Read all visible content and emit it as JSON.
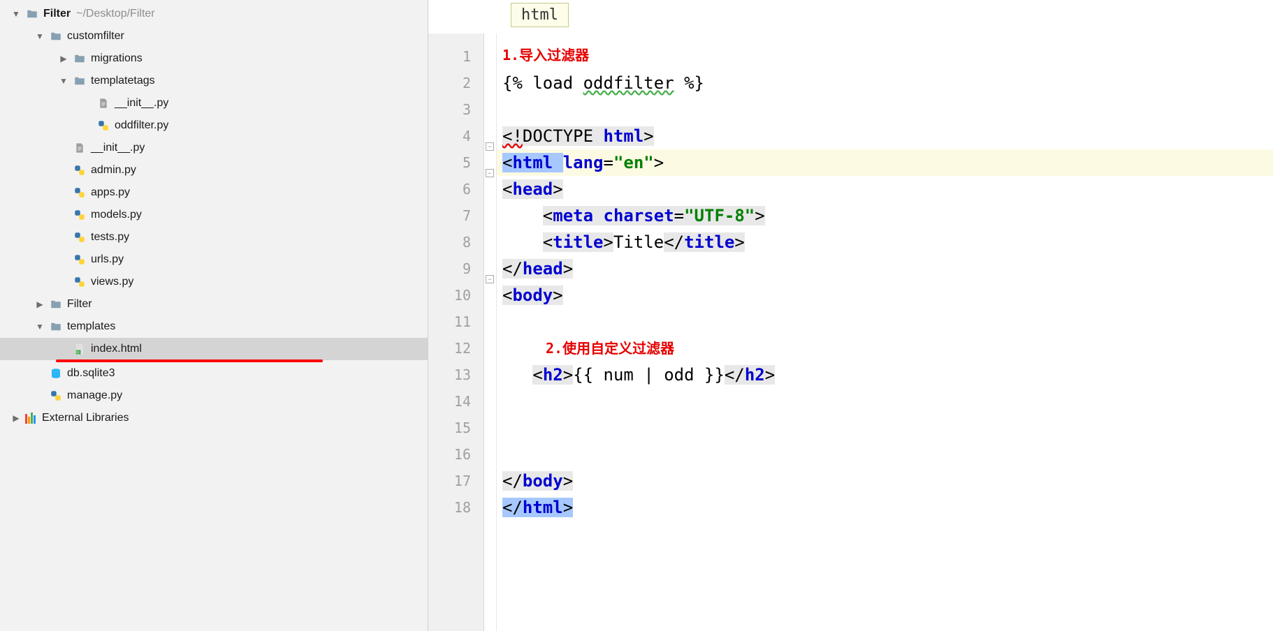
{
  "project": {
    "name": "Filter",
    "path": "~/Desktop/Filter"
  },
  "tree": [
    {
      "depth": 0,
      "arrow": "down",
      "icon": "folder",
      "label": "Filter",
      "bold": true,
      "path": "~/Desktop/Filter"
    },
    {
      "depth": 1,
      "arrow": "down",
      "icon": "folder",
      "label": "customfilter"
    },
    {
      "depth": 2,
      "arrow": "right",
      "icon": "folder",
      "label": "migrations"
    },
    {
      "depth": 2,
      "arrow": "down",
      "icon": "folder",
      "label": "templatetags"
    },
    {
      "depth": 3,
      "arrow": "none",
      "icon": "txt",
      "label": "__init__.py"
    },
    {
      "depth": 3,
      "arrow": "none",
      "icon": "py",
      "label": "oddfilter.py"
    },
    {
      "depth": 2,
      "arrow": "none",
      "icon": "txt",
      "label": "__init__.py"
    },
    {
      "depth": 2,
      "arrow": "none",
      "icon": "py",
      "label": "admin.py"
    },
    {
      "depth": 2,
      "arrow": "none",
      "icon": "py",
      "label": "apps.py"
    },
    {
      "depth": 2,
      "arrow": "none",
      "icon": "py",
      "label": "models.py"
    },
    {
      "depth": 2,
      "arrow": "none",
      "icon": "py",
      "label": "tests.py"
    },
    {
      "depth": 2,
      "arrow": "none",
      "icon": "py",
      "label": "urls.py"
    },
    {
      "depth": 2,
      "arrow": "none",
      "icon": "py",
      "label": "views.py"
    },
    {
      "depth": 1,
      "arrow": "right",
      "icon": "folder",
      "label": "Filter"
    },
    {
      "depth": 1,
      "arrow": "down",
      "icon": "folder",
      "label": "templates"
    },
    {
      "depth": 2,
      "arrow": "none",
      "icon": "html",
      "label": "index.html",
      "selected": true,
      "underline": true
    },
    {
      "depth": 1,
      "arrow": "none",
      "icon": "db",
      "label": "db.sqlite3"
    },
    {
      "depth": 1,
      "arrow": "none",
      "icon": "py",
      "label": "manage.py"
    },
    {
      "depth": 0,
      "arrow": "right",
      "icon": "lib",
      "label": "External Libraries"
    }
  ],
  "breadcrumb": "html",
  "annotations": {
    "a1": "1.导入过滤器",
    "a2": "2.使用自定义过滤器"
  },
  "code": {
    "l2_load": "{% load ",
    "l2_odd": "oddfilter",
    "l2_end": " %}",
    "l4_a": "<!",
    "l4_b": "DOCTYPE ",
    "l4_c": "html",
    "l4_d": ">",
    "l5_a": "<",
    "l5_b": "html ",
    "l5_c": "lang",
    "l5_d": "=",
    "l5_e": "\"en\"",
    "l5_f": ">",
    "l6_a": "<",
    "l6_b": "head",
    "l6_c": ">",
    "l7_pad": "    ",
    "l7_a": "<",
    "l7_b": "meta ",
    "l7_c": "charset",
    "l7_d": "=",
    "l7_e": "\"UTF-8\"",
    "l7_f": ">",
    "l8_pad": "    ",
    "l8_a": "<",
    "l8_b": "title",
    "l8_c": ">",
    "l8_d": "Title",
    "l8_e": "</",
    "l8_f": "title",
    "l8_g": ">",
    "l9_a": "</",
    "l9_b": "head",
    "l9_c": ">",
    "l10_a": "<",
    "l10_b": "body",
    "l10_c": ">",
    "l13_pad": "   ",
    "l13_a": "<",
    "l13_b": "h2",
    "l13_c": ">",
    "l13_d": "{{ num | odd }}",
    "l13_e": "</",
    "l13_f": "h2",
    "l13_g": ">",
    "l17_a": "</",
    "l17_b": "body",
    "l17_c": ">",
    "l18_a": "</",
    "l18_b": "html",
    "l18_c": ">"
  },
  "line_numbers": [
    "1",
    "2",
    "3",
    "4",
    "5",
    "6",
    "7",
    "8",
    "9",
    "10",
    "11",
    "12",
    "13",
    "14",
    "15",
    "16",
    "17",
    "18"
  ]
}
